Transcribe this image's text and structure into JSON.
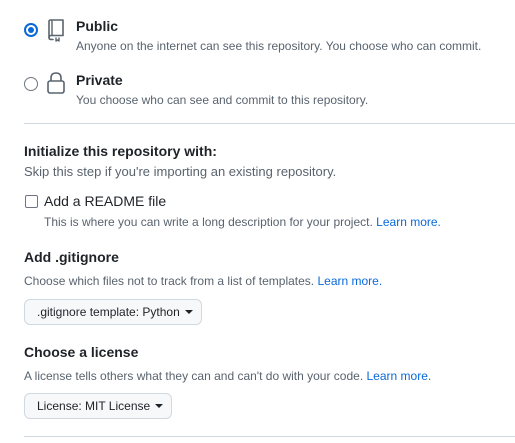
{
  "visibility": {
    "public": {
      "title": "Public",
      "description": "Anyone on the internet can see this repository. You choose who can commit.",
      "selected": true,
      "icon": "repo-icon"
    },
    "private": {
      "title": "Private",
      "description": "You choose who can see and commit to this repository.",
      "selected": false,
      "icon": "lock-icon"
    }
  },
  "initialize": {
    "title": "Initialize this repository with:",
    "description": "Skip this step if you're importing an existing repository.",
    "readme": {
      "label": "Add a README file",
      "checked": false,
      "description": "This is where you can write a long description for your project.",
      "link": "Learn more."
    }
  },
  "gitignore": {
    "title": "Add .gitignore",
    "description": "Choose which files not to track from a list of templates.",
    "link": "Learn more.",
    "select_label": ".gitignore template: Python"
  },
  "license": {
    "title": "Choose a license",
    "description": "A license tells others what they can and can't do with your code.",
    "link": "Learn more.",
    "select_label": "License: MIT License"
  },
  "colors": {
    "accent": "#0969da",
    "text": "#1f2328",
    "muted": "#59636e",
    "border": "#d1d9e0"
  }
}
